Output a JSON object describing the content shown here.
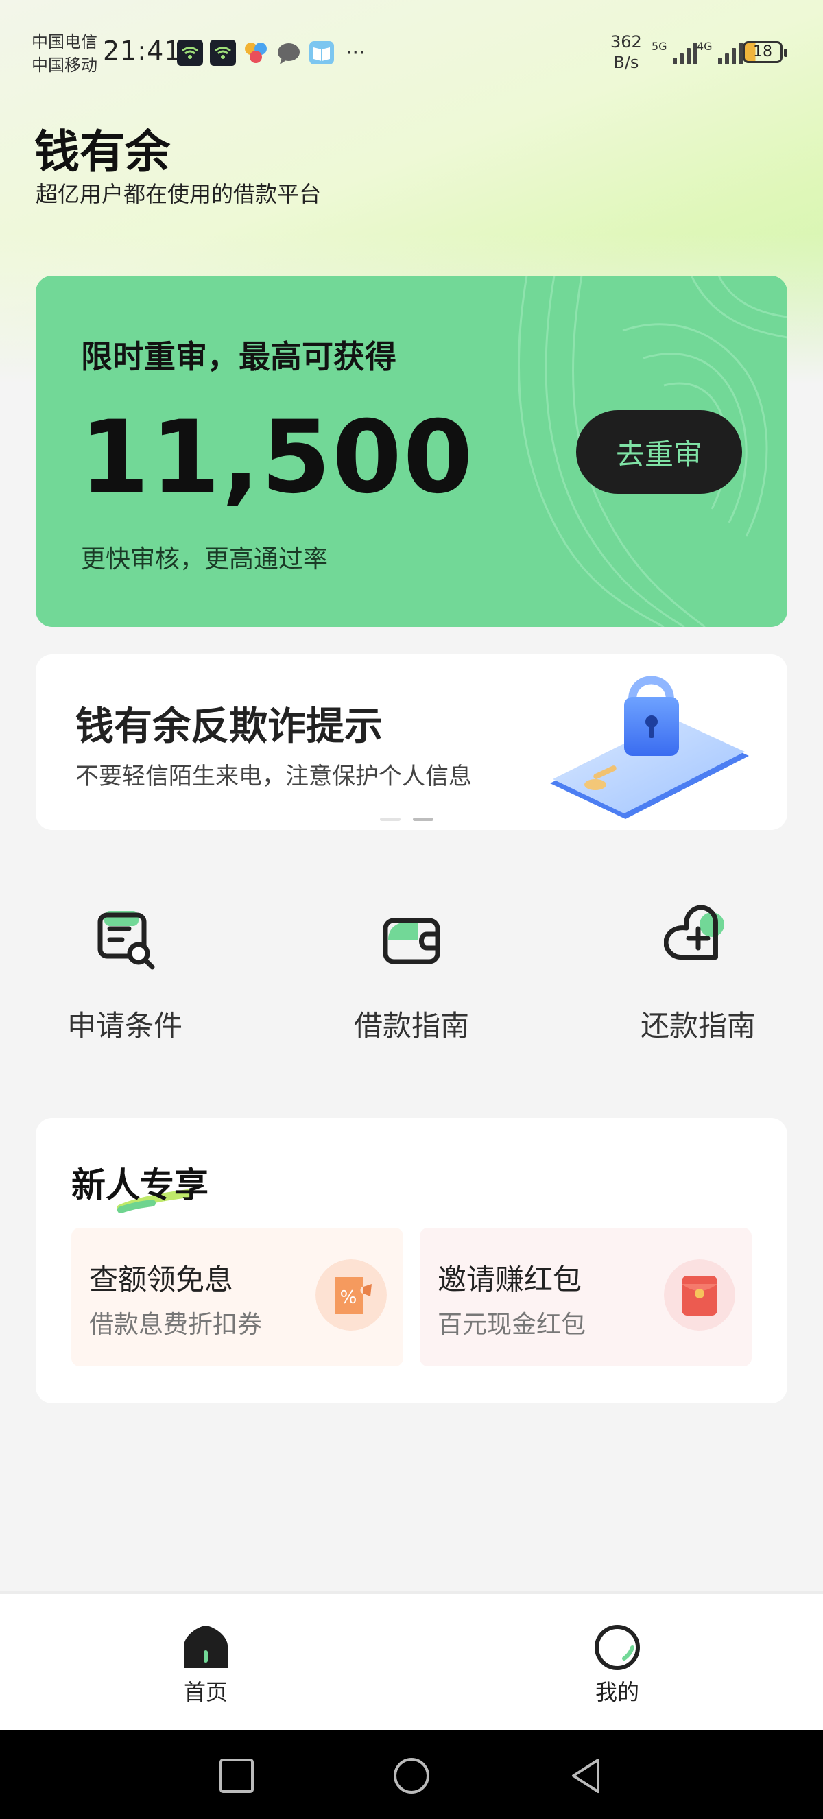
{
  "status_bar": {
    "carrier_1": "中国电信",
    "carrier_2": "中国移动",
    "time": "21:41",
    "more": "···",
    "net_speed_value": "362",
    "net_speed_unit": "B/s",
    "sig1_label": "5G",
    "sig2_label": "4G",
    "battery": "18"
  },
  "header": {
    "title": "钱有余",
    "subtitle": "超亿用户都在使用的借款平台"
  },
  "hero": {
    "headline": "限时重审，最高可获得",
    "amount": "11,500",
    "footnote": "更快审核，更高通过率",
    "button_label": "去重审"
  },
  "notice": {
    "title": "钱有余反欺诈提示",
    "subtitle": "不要轻信陌生来电，注意保护个人信息",
    "carousel_index": 2,
    "carousel_count": 2
  },
  "quick_menu": [
    {
      "label": "申请条件",
      "icon": "document-search-icon"
    },
    {
      "label": "借款指南",
      "icon": "wallet-icon"
    },
    {
      "label": "还款指南",
      "icon": "heart-plus-icon"
    }
  ],
  "new_user": {
    "title": "新人专享",
    "tiles": [
      {
        "title": "查额领免息",
        "subtitle": "借款息费折扣券",
        "icon": "discount-coupon-icon",
        "bg": "#fff6f1"
      },
      {
        "title": "邀请赚红包",
        "subtitle": "百元现金红包",
        "icon": "red-envelope-icon",
        "bg": "#fdf3f3"
      }
    ]
  },
  "bottom_nav": {
    "home": "首页",
    "mine": "我的"
  },
  "colors": {
    "accent": "#72d897",
    "hero_button_bg": "#1e1e1e",
    "hero_button_text": "#7fe2a5"
  }
}
